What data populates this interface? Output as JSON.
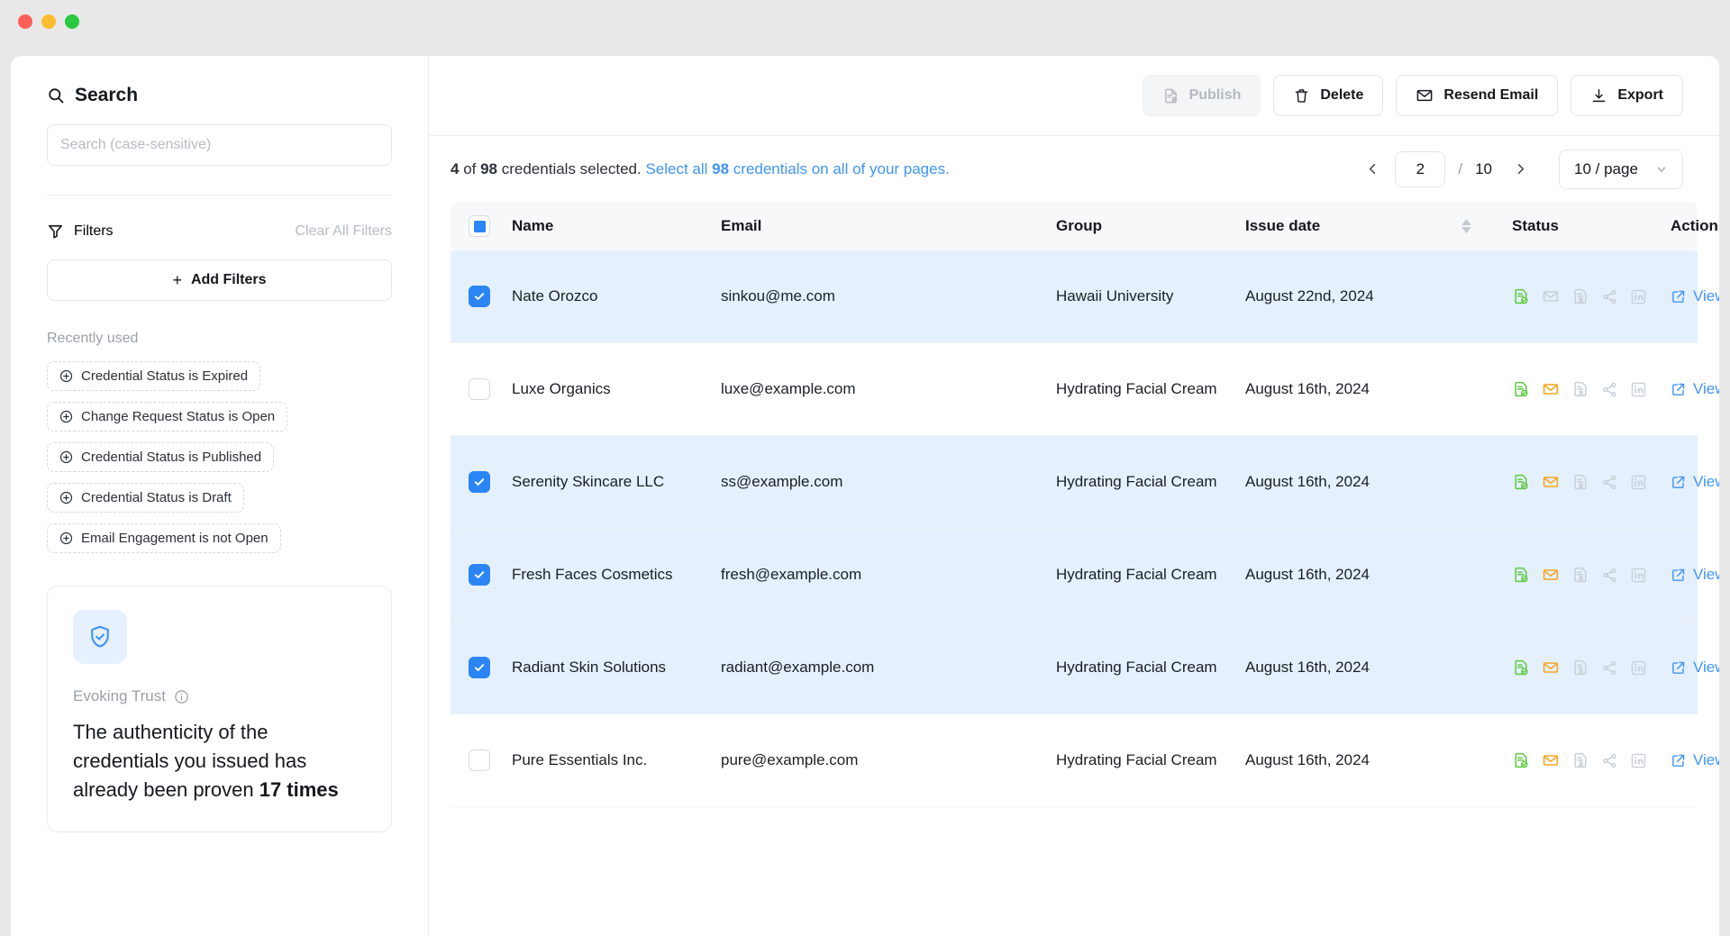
{
  "window": {
    "traffic_lights": [
      "close",
      "minimize",
      "maximize"
    ]
  },
  "sidebar": {
    "search": {
      "title": "Search",
      "icon": "search-icon",
      "value": "",
      "placeholder": "Search (case-sensitive)"
    },
    "filters": {
      "title": "Filters",
      "icon": "funnel-icon",
      "clear_all_label": "Clear All Filters",
      "add_filters_label": "Add Filters",
      "add_filters_plus": "+",
      "recently_used_label": "Recently used",
      "chips": [
        {
          "label": "Credential Status is Expired",
          "icon": "plus-circle-icon"
        },
        {
          "label": "Change Request Status is Open",
          "icon": "plus-circle-icon"
        },
        {
          "label": "Credential Status is Published",
          "icon": "plus-circle-icon"
        },
        {
          "label": "Credential Status is Draft",
          "icon": "plus-circle-icon"
        },
        {
          "label": "Email Engagement is not Open",
          "icon": "plus-circle-icon"
        }
      ]
    },
    "trust_card": {
      "icon": "shield-check-icon",
      "label": "Evoking Trust",
      "info_icon": "info-circle-icon",
      "text_before": "The authenticity of the credentials you issued has already been proven ",
      "text_highlight": "17 times"
    }
  },
  "toolbar": {
    "buttons": [
      {
        "label": "Publish",
        "icon": "publish-document-icon",
        "disabled": true
      },
      {
        "label": "Delete",
        "icon": "trash-icon",
        "disabled": false
      },
      {
        "label": "Resend Email",
        "icon": "envelope-icon",
        "disabled": false
      },
      {
        "label": "Export",
        "icon": "download-icon",
        "disabled": false
      }
    ]
  },
  "selection_bar": {
    "selected_count": "4",
    "of_word": " of ",
    "total_count": "98",
    "selected_suffix": " credentials selected. ",
    "select_all_prefix": "Select all ",
    "select_all_count": "98",
    "select_all_suffix": " credentials on all of your pages."
  },
  "pagination": {
    "prev_icon": "chevron-left-icon",
    "next_icon": "chevron-right-icon",
    "current_page": "2",
    "separator": "/",
    "total_pages": "10",
    "page_size_label": "10 / page",
    "page_size_icon": "chevron-down-icon"
  },
  "table": {
    "header_checkbox_state": "indeterminate",
    "columns": [
      {
        "key": "name",
        "label": "Name"
      },
      {
        "key": "email",
        "label": "Email"
      },
      {
        "key": "group",
        "label": "Group"
      },
      {
        "key": "issue_date",
        "label": "Issue date",
        "sortable": true,
        "sort_icon": "sort-arrows-icon"
      },
      {
        "key": "status",
        "label": "Status"
      },
      {
        "key": "actions",
        "label": "Actions"
      }
    ],
    "view_label": "View",
    "view_icon": "external-link-icon",
    "status_icon_names": [
      "credential-verified-icon",
      "email-icon",
      "credential-request-icon",
      "share-icon",
      "linkedin-icon"
    ],
    "rows": [
      {
        "selected": true,
        "name": "Nate Orozco",
        "email": "sinkou@me.com",
        "group": "Hawaii University",
        "issue_date": "August 22nd, 2024",
        "status": {
          "credential": "green",
          "email": "grey",
          "request": "grey",
          "share": "grey",
          "linkedin": "grey"
        }
      },
      {
        "selected": false,
        "name": "Luxe Organics",
        "email": "luxe@example.com",
        "group": "Hydrating Facial Cream",
        "issue_date": "August 16th, 2024",
        "status": {
          "credential": "green",
          "email": "orange",
          "request": "grey",
          "share": "grey",
          "linkedin": "grey"
        }
      },
      {
        "selected": true,
        "name": "Serenity Skincare LLC",
        "email": "ss@example.com",
        "group": "Hydrating Facial Cream",
        "issue_date": "August 16th, 2024",
        "status": {
          "credential": "green",
          "email": "orange",
          "request": "grey",
          "share": "grey",
          "linkedin": "grey"
        }
      },
      {
        "selected": true,
        "name": "Fresh Faces Cosmetics",
        "email": "fresh@example.com",
        "group": "Hydrating Facial Cream",
        "issue_date": "August 16th, 2024",
        "status": {
          "credential": "green",
          "email": "orange",
          "request": "grey",
          "share": "grey",
          "linkedin": "grey"
        }
      },
      {
        "selected": true,
        "name": "Radiant Skin Solutions",
        "email": "radiant@example.com",
        "group": "Hydrating Facial Cream",
        "issue_date": "August 16th, 2024",
        "status": {
          "credential": "green",
          "email": "orange",
          "request": "grey",
          "share": "grey",
          "linkedin": "grey"
        }
      },
      {
        "selected": false,
        "name": "Pure Essentials Inc.",
        "email": "pure@example.com",
        "group": "Hydrating Facial Cream",
        "issue_date": "August 16th, 2024",
        "status": {
          "credential": "green",
          "email": "orange",
          "request": "grey",
          "share": "grey",
          "linkedin": "grey"
        }
      }
    ]
  },
  "colors": {
    "accent_blue": "#4094f7",
    "checkbox_blue": "#2b85f5",
    "row_selected_bg": "#e4f0fd",
    "status_green": "#5cc940",
    "status_orange": "#f5a623",
    "status_grey": "#c9d0d8",
    "trust_icon_blue": "#4094f7"
  }
}
